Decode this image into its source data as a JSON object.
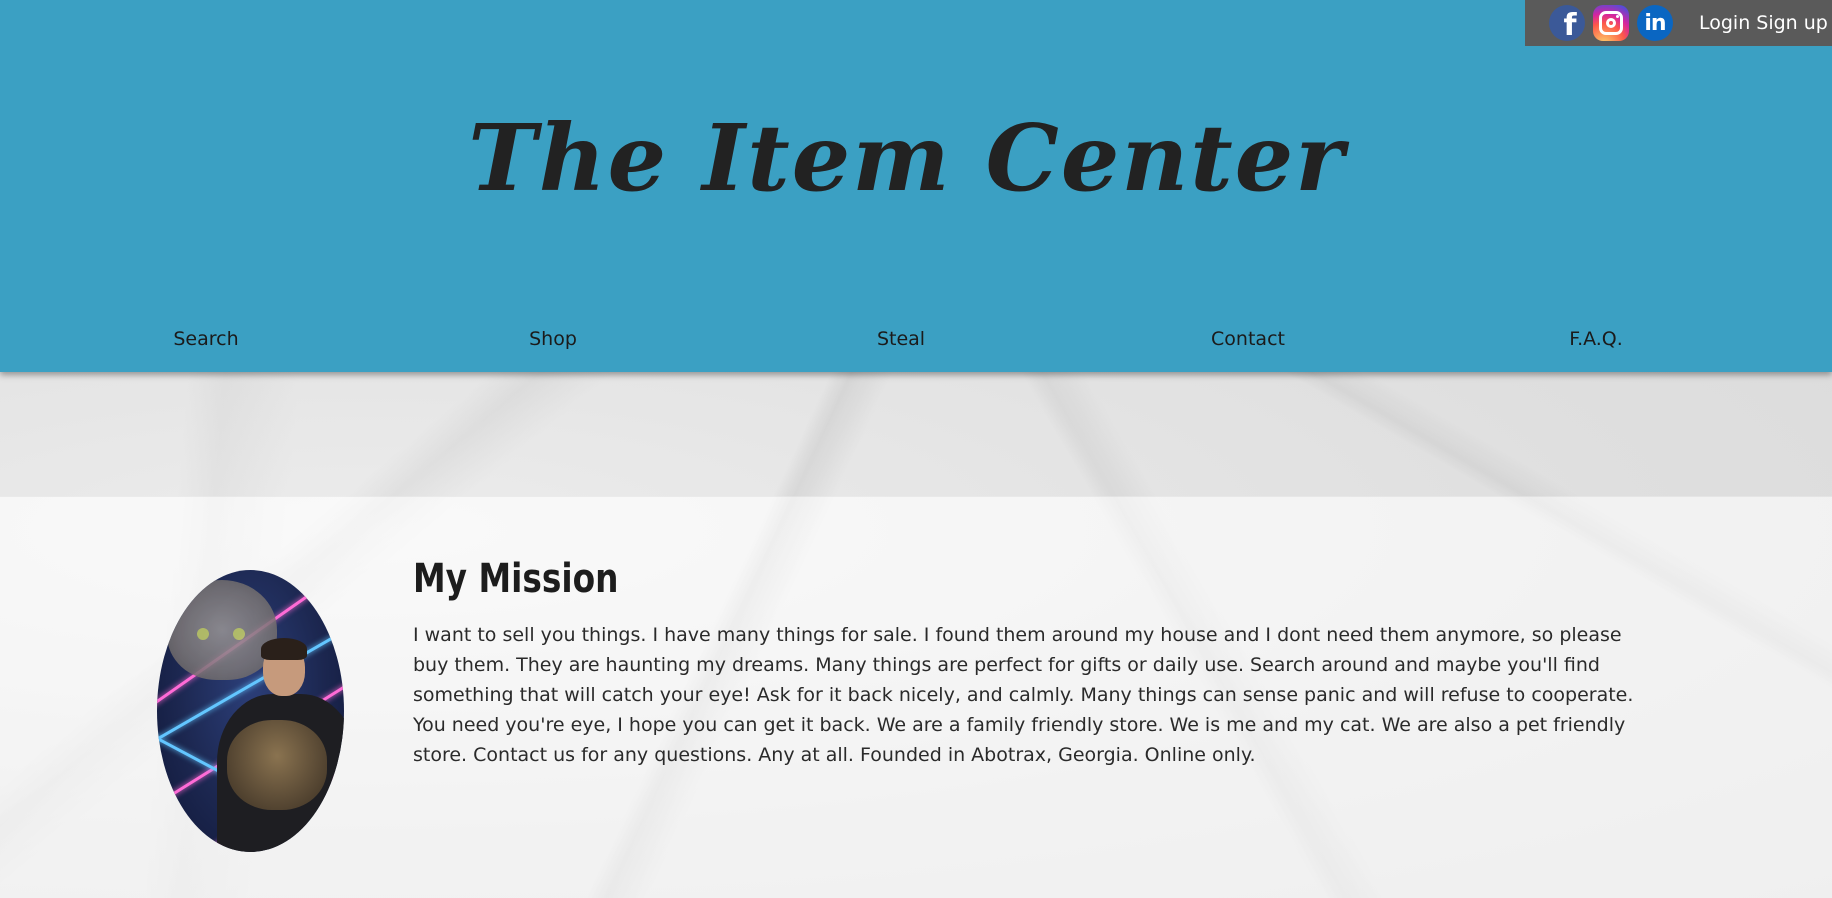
{
  "header": {
    "site_title": "The Item Center",
    "auth": {
      "login": "Login",
      "signup": "Sign up"
    },
    "social": [
      "facebook-icon",
      "instagram-icon",
      "linkedin-icon"
    ],
    "nav": [
      {
        "label": "Search"
      },
      {
        "label": "Shop"
      },
      {
        "label": "Steal"
      },
      {
        "label": "Contact"
      },
      {
        "label": "F.A.Q."
      }
    ]
  },
  "mission": {
    "title": "My Mission",
    "text": "I want to sell you things. I have many things for sale. I found them around my house and I dont need them anymore, so please buy them. They are haunting my dreams. Many things are perfect for gifts or daily use. Search around and maybe you'll find something that will catch your eye! Ask for it back nicely, and calmly. Many things can sense panic and will refuse to cooperate. You need you're eye, I hope you can get it back. We are a family friendly store. We is me and my cat. We are also a pet friendly store. Contact us for any questions. Any at all. Founded in Abotrax, Georgia. Online only."
  },
  "colors": {
    "header_bg": "#3ba0c3",
    "topbar_bg": "#5a5a5a",
    "text": "#222222"
  }
}
